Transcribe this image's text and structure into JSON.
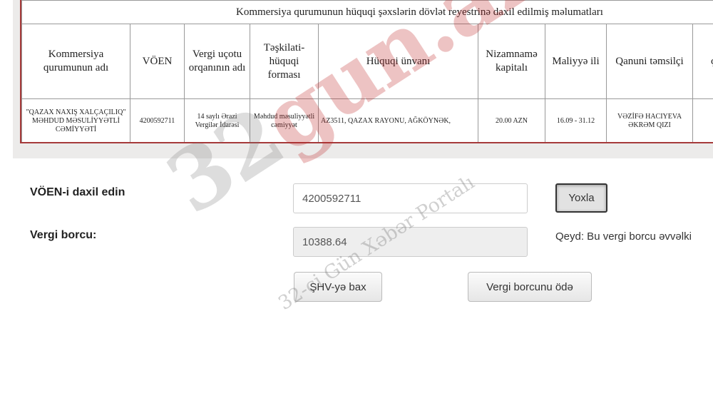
{
  "registry": {
    "title": "Kommersiya qurumunun hüquqi şəxslərin dövlət reyestrinə daxil edilmiş məlumatları",
    "headers": [
      "Kommersiya qurumunun adı",
      "VÖEN",
      "Vergi uçotu orqanının adı",
      "Təşkilati-hüquqi forması",
      "Hüquqi ünvanı",
      "Nizamnamə kapitalı",
      "Maliyyə ili",
      "Qanuni təmsilçi",
      "ç..."
    ],
    "row": [
      "\"QAZAX NAXIŞ XALÇAÇILIQ\" MƏHDUD MƏSULİYYƏTLİ CƏMİYYƏTİ",
      "4200592711",
      "14 saylı Ərazi Vergilər İdarəsi",
      "Məhdud məsuliyyətli cəmiyyət",
      "AZ3511, QAZAX RAYONU, AĞKÖYNƏK,",
      "20.00 AZN",
      "16.09 - 31.12",
      "VƏZİFƏ HACIYEVA ƏKRƏM QIZI",
      ""
    ]
  },
  "form": {
    "voen_label": "VÖEN-i daxil edin",
    "voen_value": "4200592711",
    "check_button": "Yoxla",
    "debt_label": "Vergi borcu:",
    "debt_value": "10388.64",
    "note": "Qeyd: Bu vergi borcu əvvəlki",
    "shv_button": "ŞHV-yə bax",
    "pay_button": "Vergi borcunu ödə"
  },
  "watermark": {
    "brand_grey": "32",
    "brand_red": "gun.az",
    "subtitle": "32-ci Gün Xəbər Portalı"
  }
}
